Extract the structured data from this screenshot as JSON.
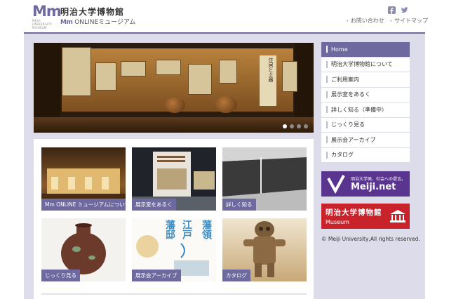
{
  "header": {
    "logo_text": "Mm",
    "logo_sub": "MEIJI UNIVERSITY MUSEUM",
    "title": "明治大学博物館",
    "subtitle_mark": "Mm",
    "subtitle": "ONLINEミュージアム",
    "links": [
      "お問い合わせ",
      "サイトマップ"
    ],
    "social": [
      "facebook-icon",
      "twitter-icon"
    ]
  },
  "hero": {
    "vertical_text": "住居と土器",
    "dots": 4,
    "active_dot": 0
  },
  "tiles": [
    {
      "label": "Mm ONLINE ミュージアムについて",
      "image": "exhibition-gallery"
    },
    {
      "label": "展示室をあるく",
      "image": "exhibit-panel"
    },
    {
      "label": "詳しく知る",
      "image": "excavation-site"
    },
    {
      "label": "じっくり見る",
      "image": "ancient-jar"
    },
    {
      "label": "展示会アーカイブ",
      "image": "exhibition-poster"
    },
    {
      "label": "カタログ",
      "image": "clay-figure"
    }
  ],
  "poster": {
    "left": "藩邸",
    "middle": "江戸",
    "right": "藩領"
  },
  "sidebar": {
    "items": [
      {
        "label": "Home",
        "active": true
      },
      {
        "label": "明治大学博物館について",
        "active": false
      },
      {
        "label": "ご利用案内",
        "active": false
      },
      {
        "label": "展示室をあるく",
        "active": false
      },
      {
        "label": "詳しく知る（準備中）",
        "active": false
      },
      {
        "label": "じっくり見る",
        "active": false
      },
      {
        "label": "展示会アーカイブ",
        "active": false
      },
      {
        "label": "カタログ",
        "active": false
      }
    ]
  },
  "banners": {
    "meiji_net_tag": "明治大学発、社会への提言。",
    "meiji_net_title": "Meiji.net",
    "museum_title": "明治大学博物館",
    "museum_sub": "Museum"
  },
  "copyright": "© Meiji University,All rights reserved.",
  "colors": {
    "accent": "#6e6a9f",
    "stage": "#dcdcea",
    "meiji_net": "#5a3590",
    "museum": "#c8232b"
  }
}
